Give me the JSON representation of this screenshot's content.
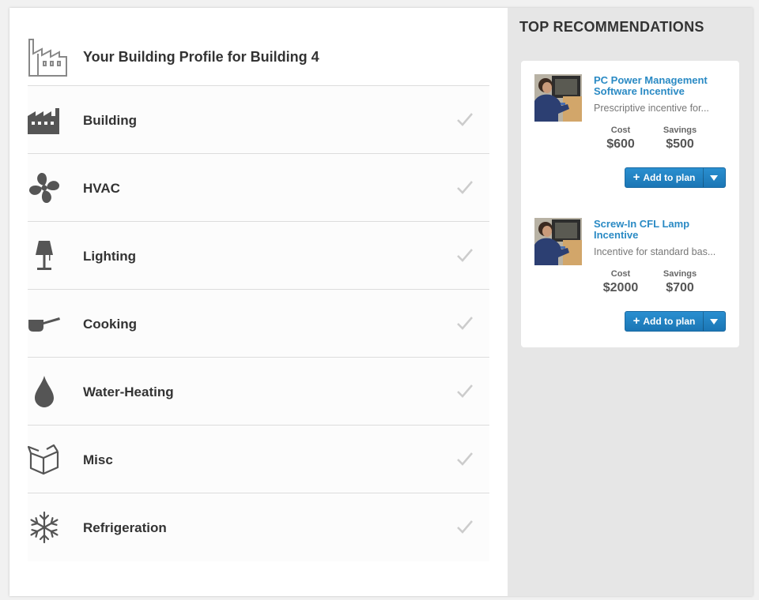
{
  "profile": {
    "title": "Your Building Profile for Building 4",
    "categories": [
      {
        "label": "Building",
        "icon": "factory-icon"
      },
      {
        "label": "HVAC",
        "icon": "fan-icon"
      },
      {
        "label": "Lighting",
        "icon": "lamp-icon"
      },
      {
        "label": "Cooking",
        "icon": "saucepan-icon"
      },
      {
        "label": "Water-Heating",
        "icon": "water-drop-icon"
      },
      {
        "label": "Misc",
        "icon": "open-box-icon"
      },
      {
        "label": "Refrigeration",
        "icon": "snowflake-icon"
      }
    ]
  },
  "recommendations": {
    "heading": "TOP RECOMMENDATIONS",
    "items": [
      {
        "name": "PC Power Management Software Incentive",
        "description": "Prescriptive incentive for...",
        "cost_label": "Cost",
        "cost": "$600",
        "savings_label": "Savings",
        "savings": "$500",
        "button_label": "Add to plan"
      },
      {
        "name": "Screw-In CFL Lamp Incentive",
        "description": "Incentive for standard bas...",
        "cost_label": "Cost",
        "cost": "$2000",
        "savings_label": "Savings",
        "savings": "$700",
        "button_label": "Add to plan"
      }
    ]
  },
  "colors": {
    "accent_blue": "#2a8ac4",
    "icon_gray": "#555555",
    "check_gray": "#cccccc",
    "sidebar_bg": "#e6e6e6"
  }
}
